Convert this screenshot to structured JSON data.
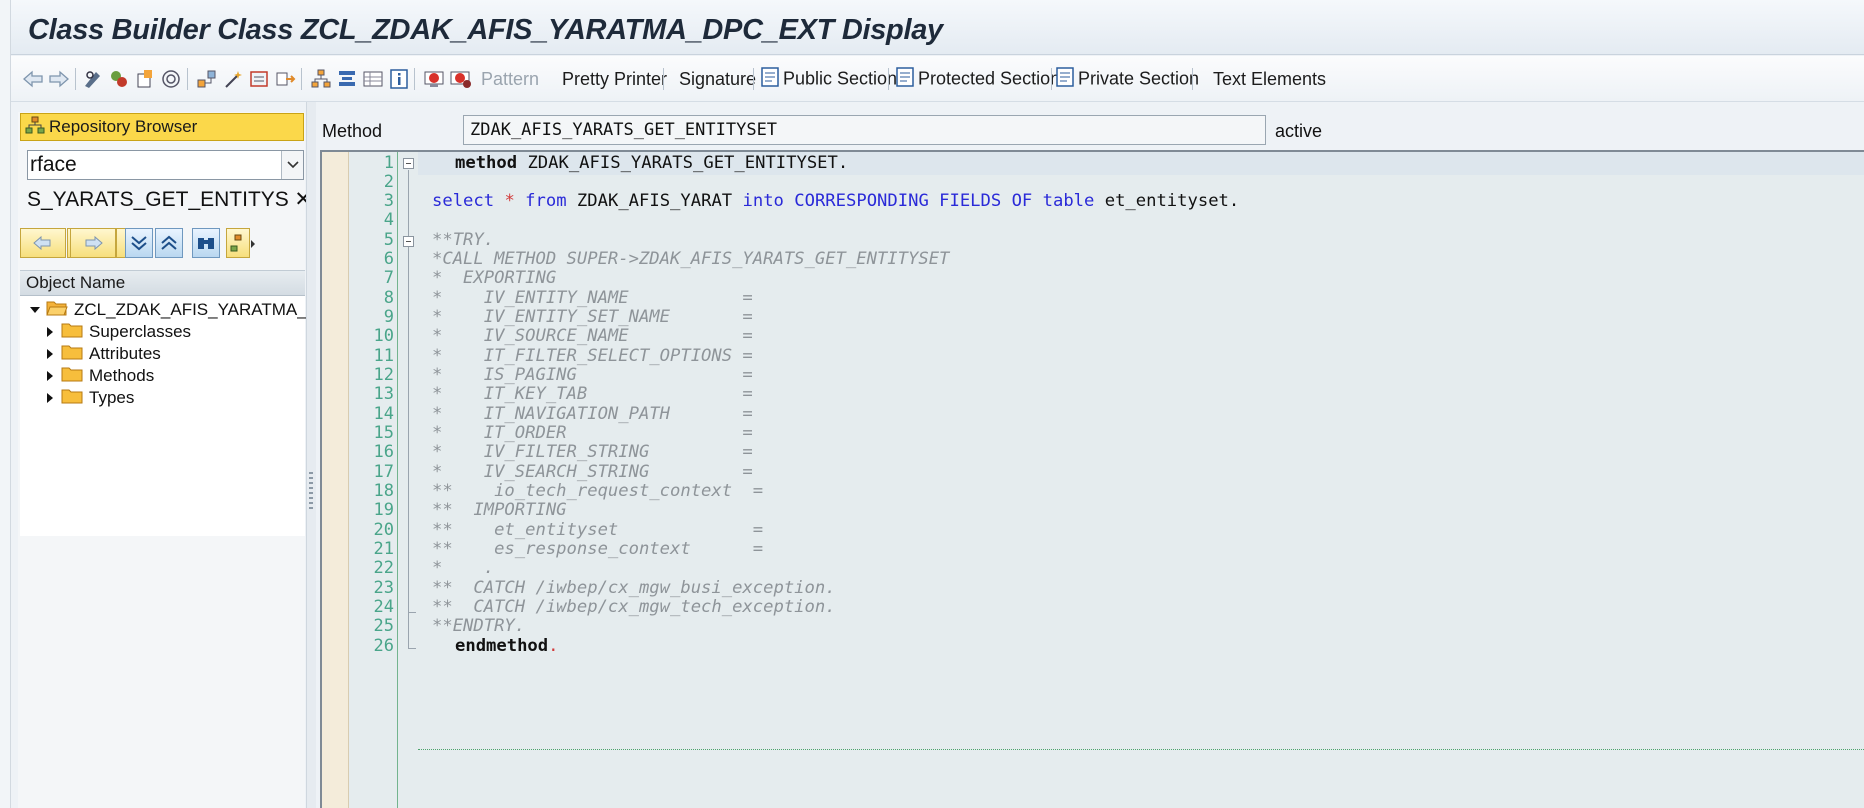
{
  "window": {
    "title": "Class Builder Class ZCL_ZDAK_AFIS_YARATMA_DPC_EXT Display"
  },
  "toolbar": {
    "pattern": "Pattern",
    "pretty_printer": "Pretty Printer",
    "signature": "Signature",
    "public_section": "Public Section",
    "protected_section": "Protected Section",
    "private_section": "Private Section",
    "text_elements": "Text Elements"
  },
  "left_panel": {
    "repository_browser": "Repository Browser",
    "combo_value": "rface",
    "object_field": "S_YARATS_GET_ENTITYS",
    "clear_symbol": "✕",
    "column_header": "Object Name",
    "tree": {
      "root": "ZCL_ZDAK_AFIS_YARATMA_",
      "children": [
        "Superclasses",
        "Attributes",
        "Methods",
        "Types"
      ]
    }
  },
  "method_header": {
    "label": "Method",
    "name": "ZDAK_AFIS_YARATS_GET_ENTITYSET",
    "status": "active"
  },
  "editor": {
    "lines": [
      {
        "n": "1"
      },
      {
        "n": "2"
      },
      {
        "n": "3"
      },
      {
        "n": "4"
      },
      {
        "n": "5"
      },
      {
        "n": "6"
      },
      {
        "n": "7"
      },
      {
        "n": "8"
      },
      {
        "n": "9"
      },
      {
        "n": "10"
      },
      {
        "n": "11"
      },
      {
        "n": "12"
      },
      {
        "n": "13"
      },
      {
        "n": "14"
      },
      {
        "n": "15"
      },
      {
        "n": "16"
      },
      {
        "n": "17"
      },
      {
        "n": "18"
      },
      {
        "n": "19"
      },
      {
        "n": "20"
      },
      {
        "n": "21"
      },
      {
        "n": "22"
      },
      {
        "n": "23"
      },
      {
        "n": "24"
      },
      {
        "n": "25"
      },
      {
        "n": "26"
      }
    ],
    "code": {
      "l1_kw": "method",
      "l1_rest": " ZDAK_AFIS_YARATS_GET_ENTITYSET.",
      "l3_select": "select",
      "l3_star": "*",
      "l3_from": "from",
      "l3_table": " ZDAK_AFIS_YARAT ",
      "l3_into": "into",
      "l3_corr": "CORRESPONDING FIELDS OF",
      "l3_tablekw": "table",
      "l3_target": " et_entityset.",
      "l5": "**TRY.",
      "l6": "*CALL METHOD SUPER->ZDAK_AFIS_YARATS_GET_ENTITYSET",
      "l7": "*  EXPORTING",
      "l8": "*    IV_ENTITY_NAME           =",
      "l9": "*    IV_ENTITY_SET_NAME       =",
      "l10": "*    IV_SOURCE_NAME           =",
      "l11": "*    IT_FILTER_SELECT_OPTIONS =",
      "l12": "*    IS_PAGING                =",
      "l13": "*    IT_KEY_TAB               =",
      "l14": "*    IT_NAVIGATION_PATH       =",
      "l15": "*    IT_ORDER                 =",
      "l16": "*    IV_FILTER_STRING         =",
      "l17": "*    IV_SEARCH_STRING         =",
      "l18": "**    io_tech_request_context  =",
      "l19": "**  IMPORTING",
      "l20": "**    et_entityset             =",
      "l21": "**    es_response_context      =",
      "l22": "*    .",
      "l23": "**  CATCH /iwbep/cx_mgw_busi_exception.",
      "l24": "**  CATCH /iwbep/cx_mgw_tech_exception.",
      "l25": "**ENDTRY.",
      "l26_kw": "endmethod",
      "l26_dot": "."
    }
  }
}
